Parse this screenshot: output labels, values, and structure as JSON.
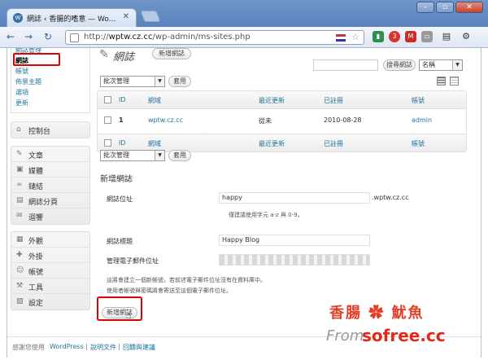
{
  "browser": {
    "tab_title": "網誌 ‹ 香腸的嗜意 — Wo...",
    "tab_favicon": "W",
    "url_prefix": "http://",
    "url_host": "wptw.cz.cc",
    "url_path": "/wp-admin/ms-sites.php",
    "ext_badge": "3"
  },
  "sidebar": {
    "sub_items": [
      "網誌管理",
      "網誌",
      "帳號",
      "佈景主題",
      "選項",
      "更新"
    ],
    "groups": [
      [
        {
          "icon": "dashboard-icon",
          "glyph": "⌂",
          "label": "控制台"
        }
      ],
      [
        {
          "icon": "pin-icon",
          "glyph": "✎",
          "label": "文章"
        },
        {
          "icon": "media-icon",
          "glyph": "▣",
          "label": "媒體"
        },
        {
          "icon": "link-icon",
          "glyph": "∞",
          "label": "鏈結"
        },
        {
          "icon": "pages-icon",
          "glyph": "▤",
          "label": "網誌分頁"
        },
        {
          "icon": "comments-icon",
          "glyph": "✉",
          "label": "迴響"
        }
      ],
      [
        {
          "icon": "appearance-icon",
          "glyph": "▦",
          "label": "外觀"
        },
        {
          "icon": "plugins-icon",
          "glyph": "✚",
          "label": "外掛"
        },
        {
          "icon": "users-icon",
          "glyph": "☺",
          "label": "帳號"
        },
        {
          "icon": "tools-icon",
          "glyph": "⚒",
          "label": "工具"
        },
        {
          "icon": "settings-icon",
          "glyph": "▧",
          "label": "設定"
        }
      ]
    ]
  },
  "main": {
    "title": "網誌",
    "add_new": "新增網誌",
    "search_button": "搜尋網誌",
    "search_type": "名稱",
    "bulk_action": "批次管理",
    "apply": "套用",
    "table": {
      "headers": [
        "ID",
        "網域",
        "最近更新",
        "已註冊",
        "帳號"
      ],
      "rows": [
        {
          "id": "1",
          "domain": "wptw.cz.cc",
          "updated": "從未",
          "registered": "2010-08-28",
          "users": "admin"
        }
      ]
    },
    "add_site": {
      "title": "新增網誌",
      "address_label": "網誌位址",
      "address_value": "happy",
      "address_suffix": ".wptw.cz.cc",
      "address_hint": "僅建議使用字元 a-z 與 0-9。",
      "title_label": "網誌標題",
      "title_value": "Happy Blog",
      "email_label": "管理電子郵件位址",
      "email_value": "",
      "note_line1": "這將會建立一個新帳號，若前述電子郵件位址沒有在資料庫中。",
      "note_line2": "使用者帳號與密碼將會寄送至這個電子郵件位址。",
      "submit": "新增網誌"
    }
  },
  "footer": {
    "thanks": "感謝您使用",
    "wordpress": "WordPress",
    "docs": "說明文件",
    "feedback": "回饋與建議"
  },
  "watermark": {
    "brand_cn": "香腸 ✿ 魷魚",
    "from": "From:",
    "site": "sofree.cc"
  }
}
